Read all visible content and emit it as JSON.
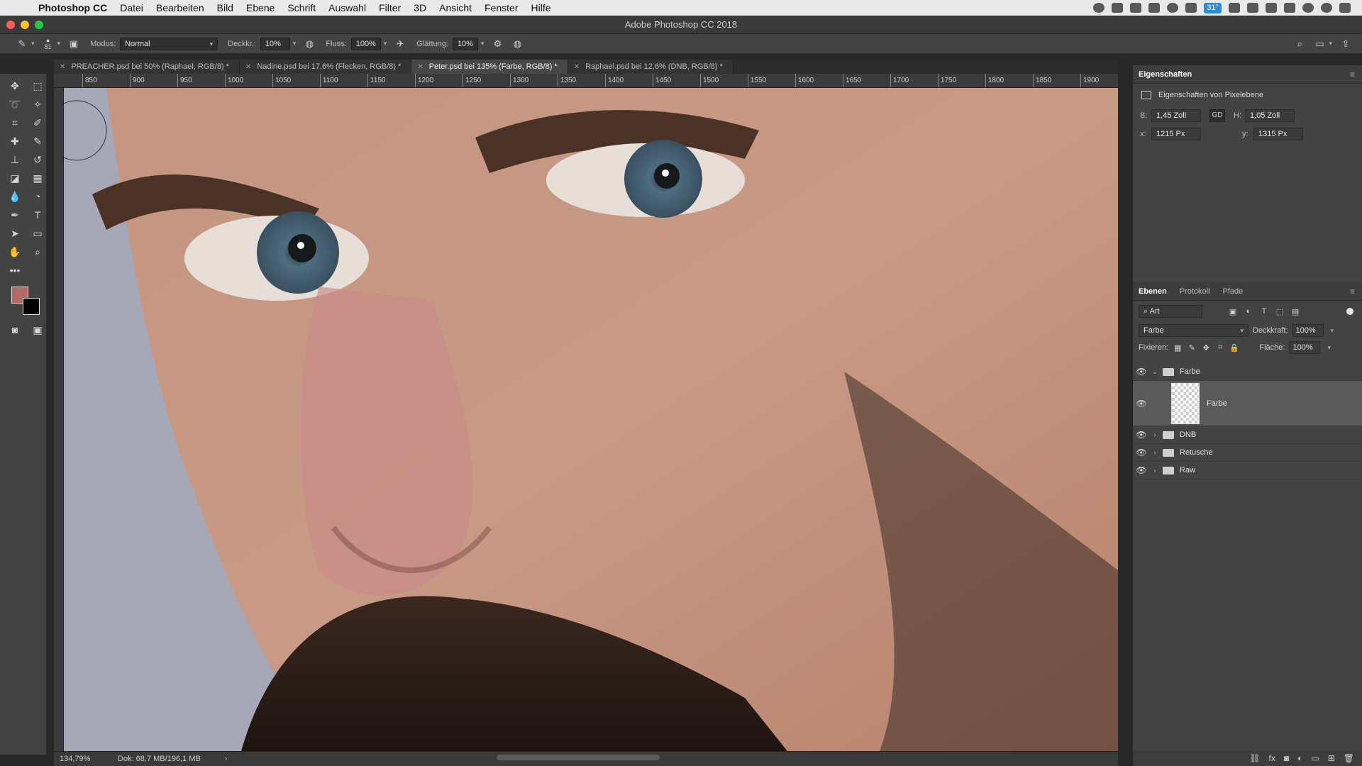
{
  "menubar": {
    "app_name": "Photoshop CC",
    "items": [
      "Datei",
      "Bearbeiten",
      "Bild",
      "Ebene",
      "Schrift",
      "Auswahl",
      "Filter",
      "3D",
      "Ansicht",
      "Fenster",
      "Hilfe"
    ],
    "temperature": "31°"
  },
  "window": {
    "title": "Adobe Photoshop CC 2018"
  },
  "options": {
    "brush_size": "81",
    "mode_label": "Modus:",
    "mode_value": "Normal",
    "opacity_label": "Deckkr.:",
    "opacity_value": "10%",
    "flow_label": "Fluss:",
    "flow_value": "100%",
    "smoothing_label": "Glättung:",
    "smoothing_value": "10%"
  },
  "tabs": [
    {
      "label": "PREACHER.psd bei 50% (Raphael, RGB/8) *"
    },
    {
      "label": "Nadine.psd bei 17,6% (Flecken, RGB/8) *"
    },
    {
      "label": "Peter.psd bei 135% (Farbe, RGB/8) *"
    },
    {
      "label": "Raphael.psd bei 12,6% (DNB, RGB/8) *"
    }
  ],
  "ruler_top": [
    "850",
    "900",
    "950",
    "1000",
    "1050",
    "1100",
    "1150",
    "1200",
    "1250",
    "1300",
    "1350",
    "1400",
    "1450",
    "1500",
    "1550",
    "1600",
    "1650",
    "1700",
    "1750",
    "1800",
    "1850",
    "1900"
  ],
  "colors": {
    "foreground": "#b36b68",
    "background": "#000000",
    "accent": "#2c8bd8"
  },
  "status": {
    "zoom": "134,79%",
    "doc": "Dok: 68,7 MB/196,1 MB"
  },
  "properties": {
    "tab": "Eigenschaften",
    "title": "Eigenschaften von Pixelebene",
    "w_label": "B:",
    "w_value": "1,45 Zoll",
    "h_label": "H:",
    "h_value": "1,05 Zoll",
    "x_label": "x:",
    "x_value": "1215 Px",
    "y_label": "y:",
    "y_value": "1315 Px"
  },
  "layers_panel": {
    "tabs": [
      "Ebenen",
      "Protokoll",
      "Pfade"
    ],
    "kind": "Art",
    "blend_mode": "Farbe",
    "opacity_label": "Deckkraft:",
    "opacity_value": "100%",
    "lock_label": "Fixieren:",
    "fill_label": "Fläche:",
    "fill_value": "100%",
    "layers": [
      {
        "name": "Farbe",
        "type": "group",
        "expanded": true
      },
      {
        "name": "Farbe",
        "type": "pixel",
        "selected": true
      },
      {
        "name": "DNB",
        "type": "group"
      },
      {
        "name": "Retusche",
        "type": "group"
      },
      {
        "name": "Raw",
        "type": "group"
      }
    ]
  }
}
